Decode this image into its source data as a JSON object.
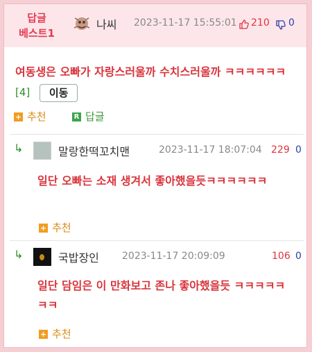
{
  "header": {
    "badge_line1": "답글",
    "badge_line2": "베스트1",
    "nickname": "나씨",
    "date": "2023-11-17 15:55:01",
    "upvotes": "210",
    "downvotes": "0"
  },
  "main_comment": {
    "text": "여동생은 오빠가 자랑스러울까 수치스러울까 ㅋㅋㅋㅋㅋㅋ",
    "reply_count": "[4]",
    "move_label": "이동",
    "recommend_label": "추천",
    "recommend_icon": "+",
    "reply_label": "답글",
    "reply_icon": "R"
  },
  "replies": [
    {
      "nickname": "말랑한떡꼬치맨",
      "date": "2023-11-17 18:07:04",
      "upvotes": "229",
      "downvotes": "0",
      "text": "일단 오빠는 소재 생겨서 좋아했을듯ㅋㅋㅋㅋㅋㅋ",
      "recommend_label": "추천",
      "arrow": "↳"
    },
    {
      "nickname": "국밥장인",
      "date": "2023-11-17 20:09:09",
      "upvotes": "106",
      "downvotes": "0",
      "text": "일단 담임은 이 만화보고 존나 좋아했을듯 ㅋㅋㅋㅋㅋㅋㅋ",
      "recommend_label": "추천",
      "arrow": "↳"
    }
  ],
  "colors": {
    "accent_red": "#d9343c",
    "reply_green": "#3a9a3a",
    "recommend_orange": "#d98c17",
    "down_blue": "#2d3fa7",
    "header_bg": "#fde6ea"
  }
}
